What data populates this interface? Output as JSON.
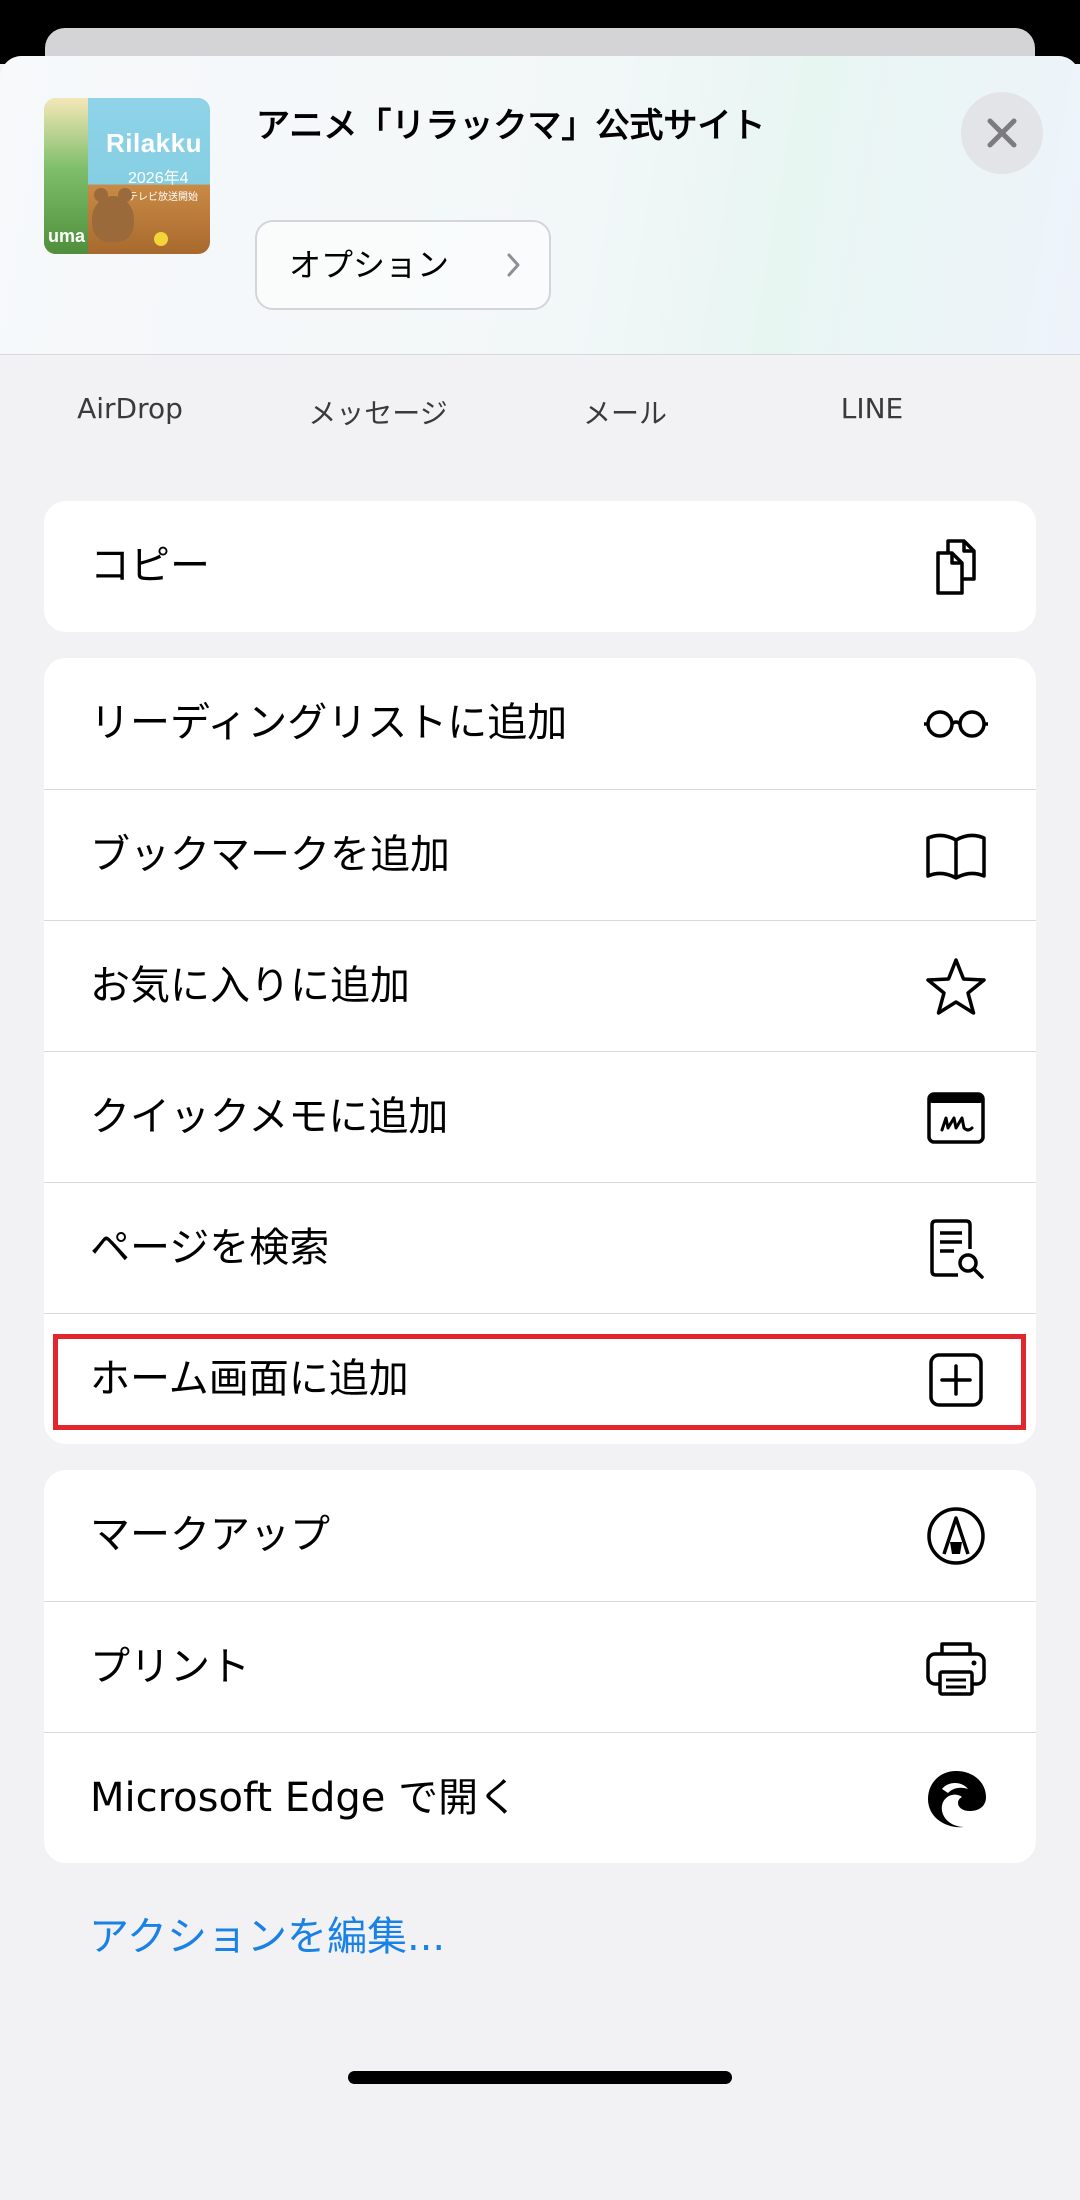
{
  "header": {
    "site_title": "アニメ「リラックマ」公式サイト",
    "options_label": "オプション",
    "thumbnail": {
      "title": "Rilakku",
      "date": "2026年4",
      "note": "テレビ放送開始",
      "bottom": "uma"
    }
  },
  "apps": [
    {
      "label": "AirDrop",
      "color": "#ffffff"
    },
    {
      "label": "メッセージ",
      "color": "#32c759"
    },
    {
      "label": "メール",
      "color": "#1fa9f5"
    },
    {
      "label": "LINE",
      "color": "#06c755"
    }
  ],
  "groups": [
    {
      "rows": [
        {
          "label": "コピー",
          "icon": "copy-icon"
        }
      ]
    },
    {
      "rows": [
        {
          "label": "リーディングリストに追加",
          "icon": "glasses-icon"
        },
        {
          "label": "ブックマークを追加",
          "icon": "book-icon"
        },
        {
          "label": "お気に入りに追加",
          "icon": "star-icon"
        },
        {
          "label": "クイックメモに追加",
          "icon": "quick-note-icon"
        },
        {
          "label": "ページを検索",
          "icon": "find-on-page-icon"
        },
        {
          "label": "ホーム画面に追加",
          "icon": "add-square-icon"
        }
      ]
    },
    {
      "rows": [
        {
          "label": "マークアップ",
          "icon": "markup-icon"
        },
        {
          "label": "プリント",
          "icon": "printer-icon"
        },
        {
          "label": "Microsoft Edge で開く",
          "icon": "edge-icon"
        }
      ]
    }
  ],
  "edit_actions": "アクションを編集...",
  "colors": {
    "link": "#1a82e6",
    "highlight": "#e1262d",
    "background": "#f2f2f4"
  }
}
